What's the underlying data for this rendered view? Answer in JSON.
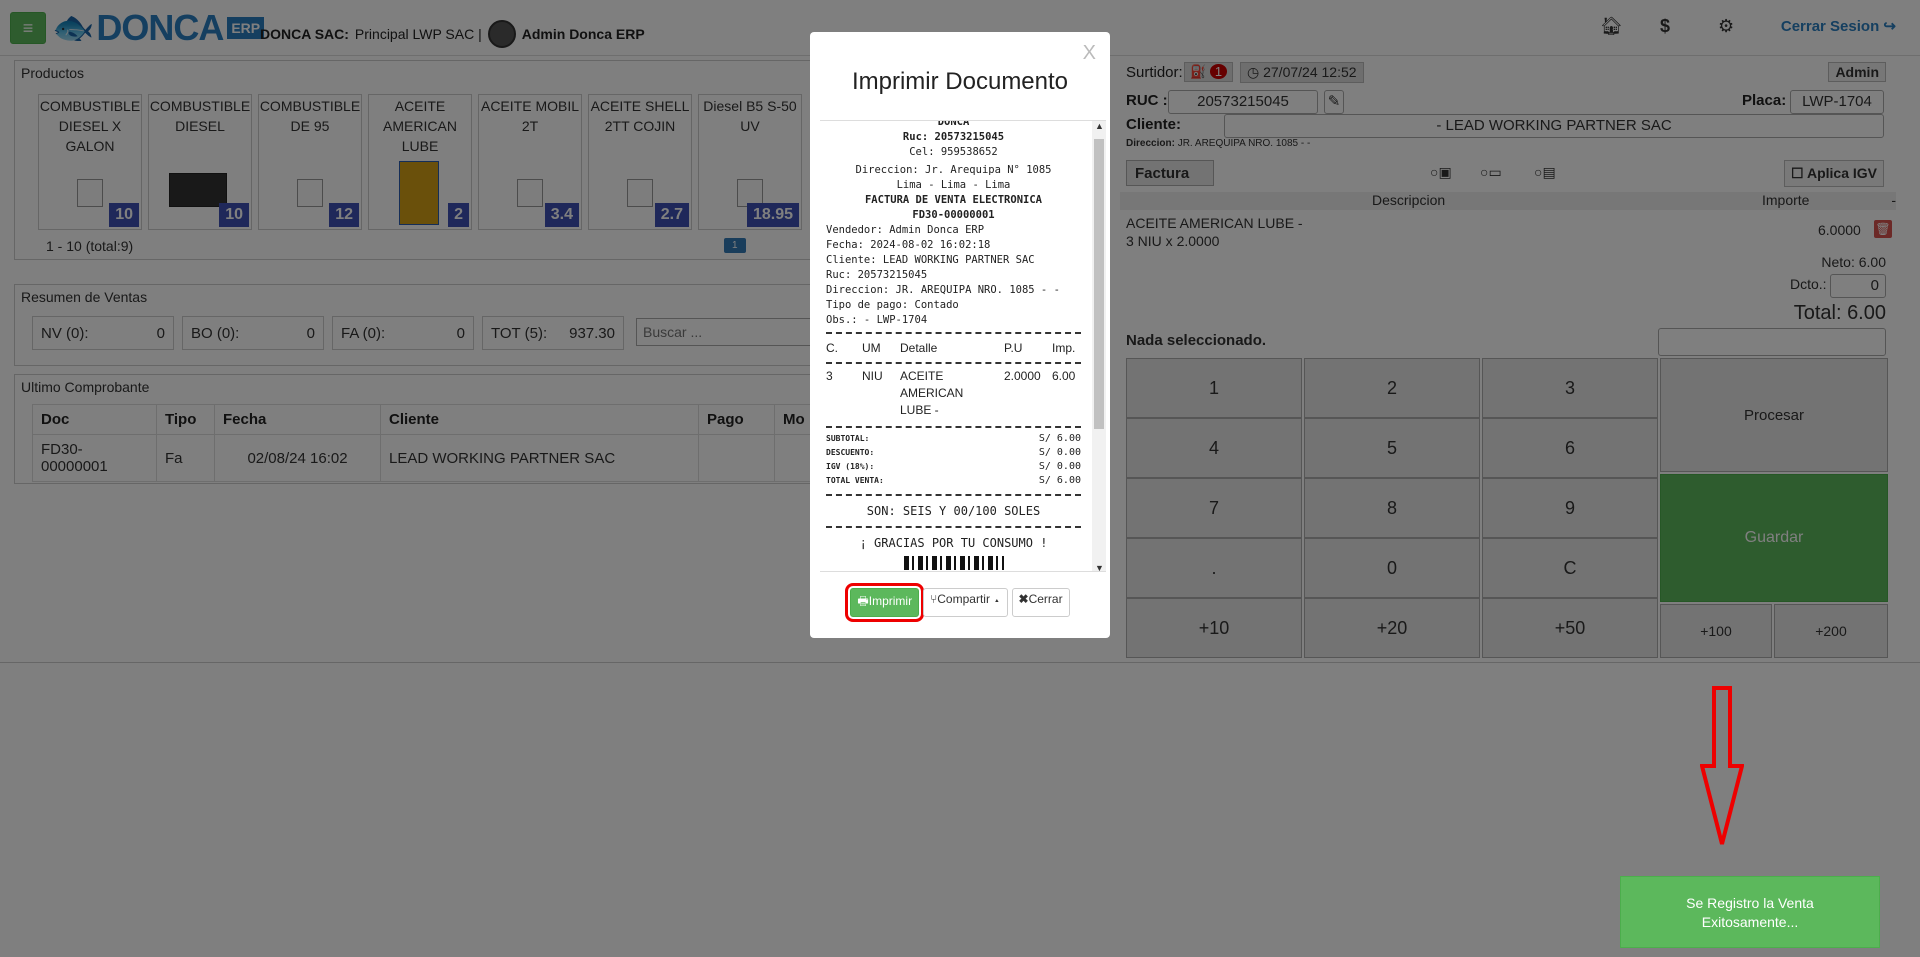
{
  "header": {
    "menu_label": "≡",
    "logo_text": "DONCA",
    "logo_badge": "ERP",
    "company_bold": "DONCA SAC:",
    "company_branch": "Principal LWP SAC |",
    "user_name": "Admin Donca ERP",
    "logout_label": "Cerrar Sesion"
  },
  "products": {
    "title": "Productos",
    "items": [
      {
        "name": "COMBUSTIBLE DIESEL X GALON",
        "stock": "10"
      },
      {
        "name": "COMBUSTIBLE DIESEL",
        "stock": "10"
      },
      {
        "name": "COMBUSTIBLE DE 95",
        "stock": "12"
      },
      {
        "name": "ACEITE AMERICAN LUBE",
        "stock": "2"
      },
      {
        "name": "ACEITE MOBIL 2T",
        "stock": "3.4"
      },
      {
        "name": "ACEITE SHELL 2TT COJIN",
        "stock": "2.7"
      },
      {
        "name": "Diesel B5 S-50 UV",
        "stock": "18.95"
      }
    ],
    "pagination": "1 - 10 (total:9)",
    "page": "1"
  },
  "sales_summary": {
    "title": "Resumen de Ventas",
    "nv_label": "NV (0):",
    "nv_value": "0",
    "bo_label": "BO (0):",
    "bo_value": "0",
    "fa_label": "FA (0):",
    "fa_value": "0",
    "tot_label": "TOT (5):",
    "tot_value": "937.30",
    "search_placeholder": "Buscar ..."
  },
  "last_receipt": {
    "title": "Ultimo Comprobante",
    "columns": [
      "Doc",
      "Tipo",
      "Fecha",
      "Cliente",
      "Pago",
      "Mo"
    ],
    "row": [
      "FD30-00000001",
      "Fa",
      "02/08/24 16:02",
      "LEAD WORKING PARTNER SAC",
      "",
      ""
    ]
  },
  "sale": {
    "surtidor_label": "Surtidor:",
    "surtidor_count": "1",
    "datetime": "27/07/24 12:52",
    "admin_label": "Admin",
    "ruc_label": "RUC :",
    "ruc_value": "20573215045",
    "placa_label": "Placa:",
    "placa_value": "LWP-1704",
    "cliente_label": "Cliente:",
    "cliente_value": "- LEAD WORKING PARTNER SAC",
    "direccion_label": "Direccion:",
    "direccion_value": "JR. AREQUIPA NRO. 1085 - -",
    "doc_type": "Factura",
    "aplica_igv": "Aplica IGV",
    "col_descripcion": "Descripcion",
    "col_importe": "Importe",
    "col_dash": "-",
    "item_line1": "ACEITE AMERICAN LUBE -",
    "item_line2": "3 NIU x 2.0000",
    "item_importe": "6.0000",
    "neto": "Neto: 6.00",
    "dcto_label": "Dcto.:",
    "dcto_value": "0",
    "total": "Total: 6.00",
    "nada": "Nada seleccionado."
  },
  "keypad": {
    "k1": "1",
    "k2": "2",
    "k3": "3",
    "k4": "4",
    "k5": "5",
    "k6": "6",
    "k7": "7",
    "k8": "8",
    "k9": "9",
    "kdot": ".",
    "k0": "0",
    "kc": "C",
    "k10": "+10",
    "k20": "+20",
    "k50": "+50",
    "k100": "+100",
    "k200": "+200",
    "procesar": "Procesar",
    "guardar": "Guardar"
  },
  "modal": {
    "close_x": "X",
    "title": "Imprimir Documento",
    "receipt": {
      "company": "DONCA",
      "ruc": "Ruc: 20573215045",
      "cel": "Cel: 959538652",
      "direccion": "Direccion: Jr. Arequipa N° 1085",
      "ciudad": "Lima - Lima - Lima",
      "doc_title": "FACTURA DE VENTA ELECTRONICA",
      "doc_number": "FD30-00000001",
      "vendedor": "Vendedor: Admin Donca ERP",
      "fecha": "Fecha: 2024-08-02 16:02:18",
      "cliente": "Cliente: LEAD WORKING PARTNER SAC",
      "ruc_cliente": "Ruc: 20573215045",
      "dir_cliente": "Direccion: JR. AREQUIPA NRO. 1085 - -",
      "tipo_pago": "Tipo de pago: Contado",
      "obs": "Obs.: - LWP-1704",
      "h_c": "C.",
      "h_um": "UM",
      "h_detalle": "Detalle",
      "h_pu": "P.U",
      "h_imp": "Imp.",
      "i_c": "3",
      "i_um": "NIU",
      "i_detalle": "ACEITE AMERICAN LUBE -",
      "i_pu": "2.0000",
      "i_imp": "6.00",
      "subtotal_label": "SUBTOTAL:",
      "subtotal": "S/ 6.00",
      "descuento_label": "DESCUENTO:",
      "descuento": "S/ 0.00",
      "igv_label": "IGV (18%):",
      "igv": "S/ 0.00",
      "total_label": "TOTAL VENTA:",
      "total": "S/ 6.00",
      "son": "SON: SEIS Y 00/100 SOLES",
      "gracias": "¡ GRACIAS POR TU CONSUMO !"
    },
    "print_label": "Imprimir",
    "share_label": "Compartir",
    "close_label": "Cerrar"
  },
  "toast": {
    "line1": "Se Registro la Venta",
    "line2": "Exitosamente..."
  }
}
